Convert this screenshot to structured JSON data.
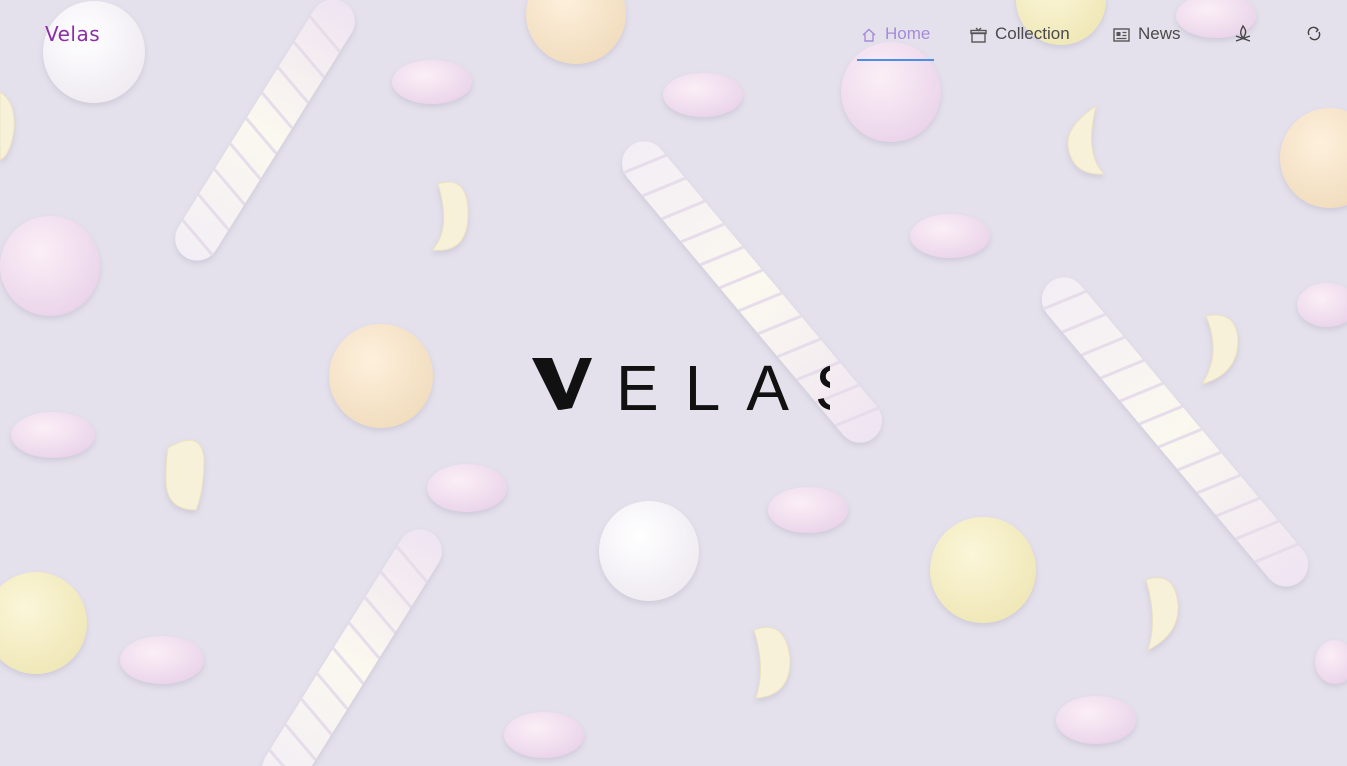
{
  "brand": {
    "name": "Velas",
    "color": "#8a2fa6"
  },
  "nav": {
    "items": [
      {
        "label": "Home",
        "icon": "home-icon",
        "active": true
      },
      {
        "label": "Collection",
        "icon": "collection-box-icon",
        "active": false
      },
      {
        "label": "News",
        "icon": "news-icon",
        "active": false
      }
    ],
    "extra_icons": [
      "campfire-icon",
      "refresh-link-icon"
    ],
    "active_color": "#a58bd8",
    "underline_color": "#4a8ee8"
  },
  "hero": {
    "logo_text": "ELAS",
    "logo_mark": "V"
  },
  "background": {
    "description_icon": "marshmallow-pattern",
    "base_color": "#e4e1ec"
  }
}
